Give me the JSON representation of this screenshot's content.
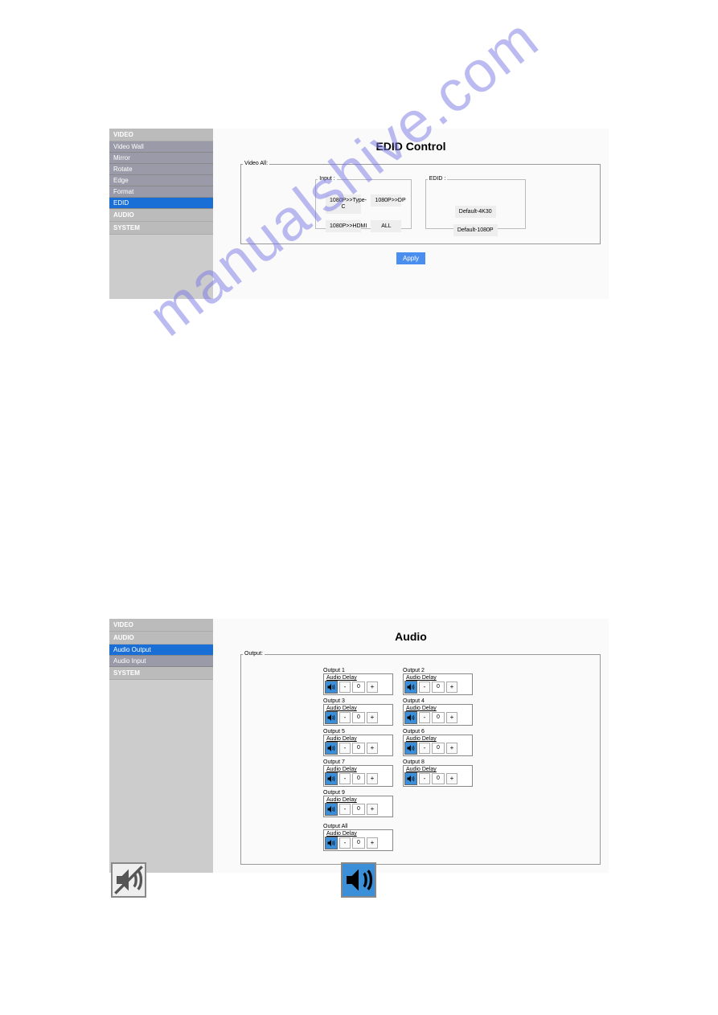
{
  "watermark": "manualshive.com",
  "screen1": {
    "sidebar": {
      "sections": [
        {
          "header": "VIDEO",
          "items": [
            "Video Wall",
            "Mirror",
            "Rotate",
            "Edge",
            "Format",
            "EDID"
          ],
          "active": "EDID"
        },
        {
          "header": "AUDIO",
          "items": []
        },
        {
          "header": "SYSTEM",
          "items": []
        }
      ]
    },
    "title": "EDID Control",
    "outer_legend": "Video All:",
    "input_legend": "Input :",
    "input_buttons": [
      "1080P>>Type-C",
      "1080P>>DP",
      "1080P>>HDMI",
      "ALL"
    ],
    "edid_legend": "EDID :",
    "edid_buttons": [
      "Default-4K30",
      "Default-1080P"
    ],
    "apply": "Apply"
  },
  "screen2": {
    "sidebar": {
      "sections": [
        {
          "header": "VIDEO",
          "items": []
        },
        {
          "header": "AUDIO",
          "items": [
            "Audio Output",
            "Audio Input"
          ],
          "active": "Audio Output"
        },
        {
          "header": "SYSTEM",
          "items": []
        }
      ]
    },
    "title": "Audio",
    "outer_legend": "Output:",
    "audio_delay_label": "Audio Delay",
    "outputs": [
      {
        "label": "Output 1",
        "value": "0"
      },
      {
        "label": "Output 2",
        "value": "0"
      },
      {
        "label": "Output 3",
        "value": "0"
      },
      {
        "label": "Output 4",
        "value": "0"
      },
      {
        "label": "Output 5",
        "value": "0"
      },
      {
        "label": "Output 6",
        "value": "0"
      },
      {
        "label": "Output 7",
        "value": "0"
      },
      {
        "label": "Output 8",
        "value": "0"
      },
      {
        "label": "Output 9",
        "value": "0"
      }
    ],
    "output_all": {
      "label": "Output All",
      "value": "0"
    },
    "minus": "-",
    "plus": "+"
  }
}
